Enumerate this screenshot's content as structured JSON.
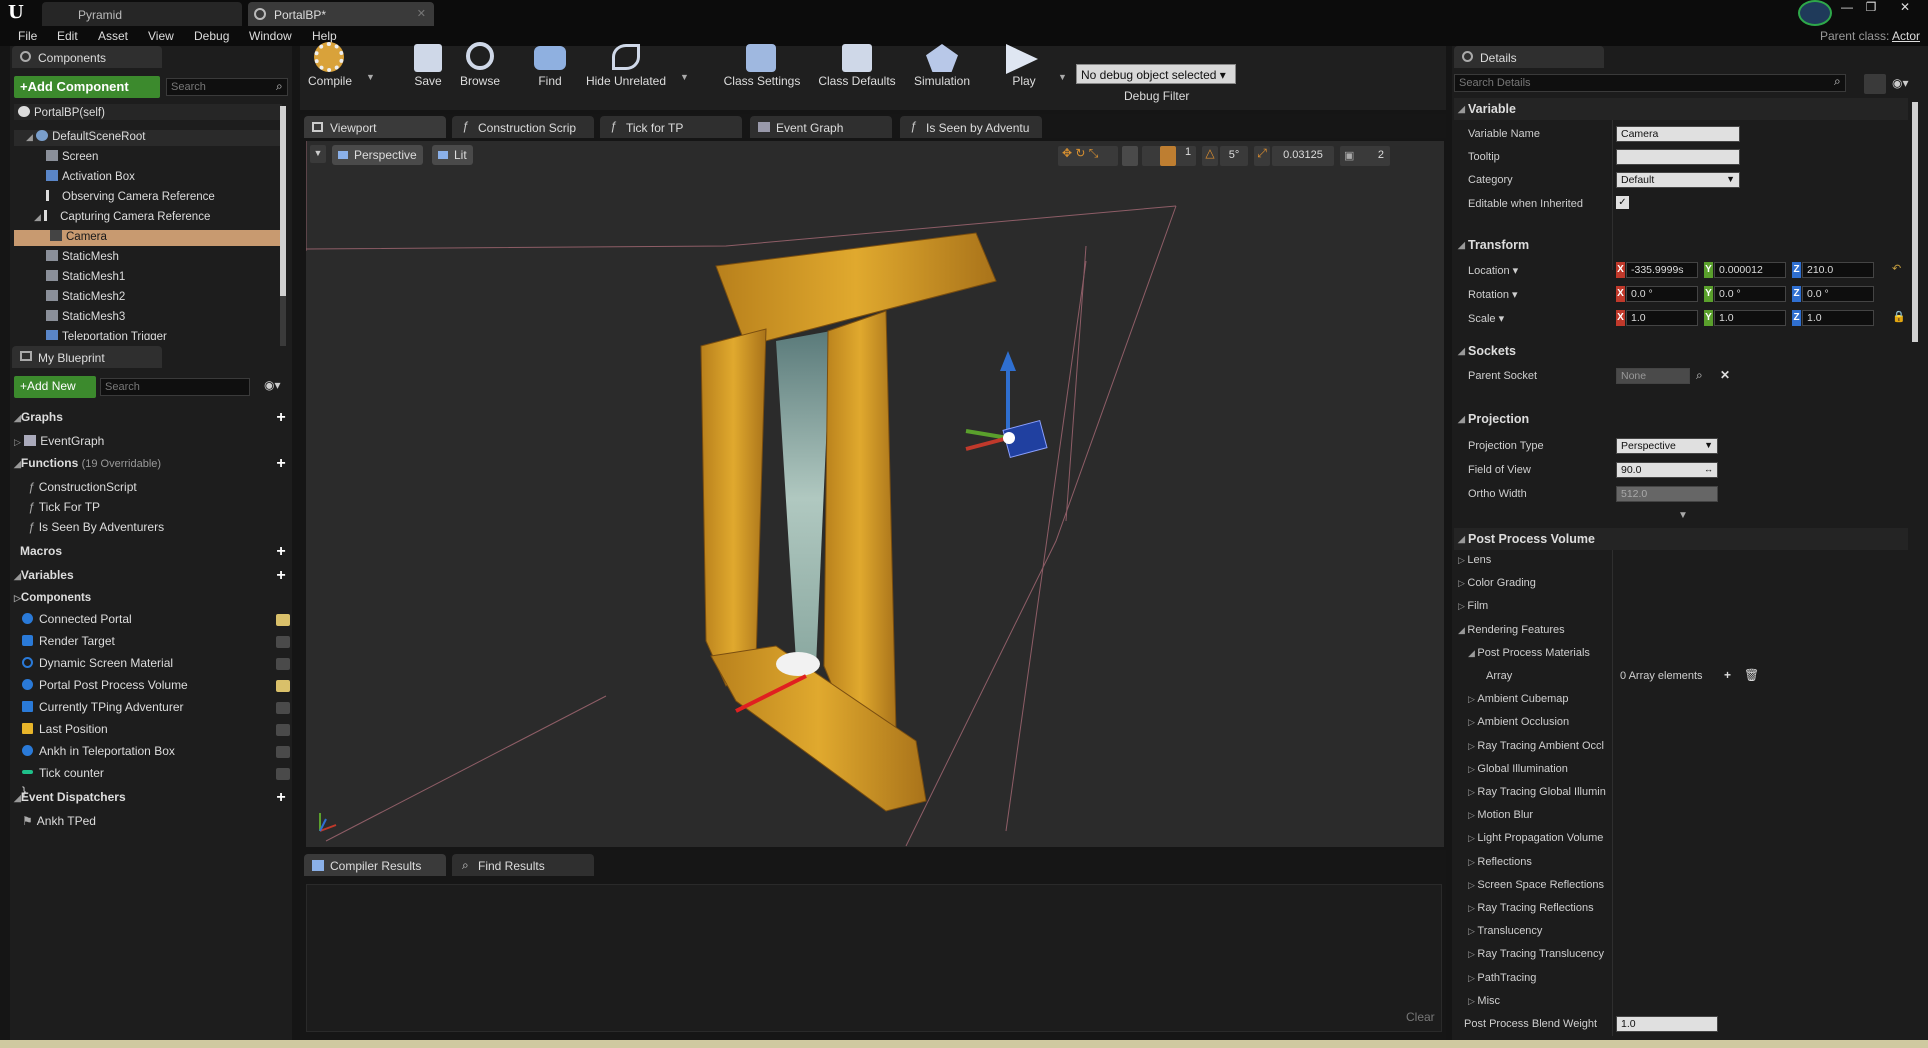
{
  "tabs": [
    {
      "label": "Pyramid"
    },
    {
      "label": "PortalBP*"
    }
  ],
  "menu": [
    "File",
    "Edit",
    "Asset",
    "View",
    "Debug",
    "Window",
    "Help"
  ],
  "parent_class": {
    "label": "Parent class:",
    "value": "Actor"
  },
  "components": {
    "title": "Components",
    "add_label": "+Add Component",
    "search_placeholder": "Search",
    "self_label": "PortalBP(self)",
    "items": [
      "DefaultSceneRoot",
      "Screen",
      "Activation Box",
      "Observing Camera Reference",
      "Capturing Camera Reference",
      "Camera",
      "StaticMesh",
      "StaticMesh1",
      "StaticMesh2",
      "StaticMesh3",
      "Teleportation Trigger"
    ]
  },
  "blueprint": {
    "title": "My Blueprint",
    "add_label": "+Add New",
    "search_placeholder": "Search",
    "graphs_label": "Graphs",
    "event_graph": "EventGraph",
    "functions_label": "Functions",
    "functions_count": "(19 Overridable)",
    "functions": [
      "ConstructionScript",
      "Tick For TP",
      "Is Seen By Adventurers"
    ],
    "macros_label": "Macros",
    "variables_label": "Variables",
    "components_label": "Components",
    "variables": [
      "Connected Portal",
      "Render Target",
      "Dynamic Screen Material",
      "Portal Post Process Volume",
      "Currently TPing Adventurer",
      "Last Position",
      "Ankh in Teleportation Box",
      "Tick counter"
    ],
    "dispatchers_label": "Event Dispatchers",
    "dispatchers": [
      "Ankh TPed"
    ]
  },
  "toolbar": {
    "compile": "Compile",
    "save": "Save",
    "browse": "Browse",
    "find": "Find",
    "hide_unrelated": "Hide Unrelated",
    "class_settings": "Class Settings",
    "class_defaults": "Class Defaults",
    "simulation": "Simulation",
    "play": "Play",
    "debug_object": "No debug object selected",
    "debug_filter": "Debug Filter"
  },
  "editor_tabs": [
    "Viewport",
    "Construction Scrip",
    "Tick for TP",
    "Event Graph",
    "Is Seen by Adventu"
  ],
  "viewport": {
    "perspective": "Perspective",
    "lit": "Lit",
    "snap_angle": "5°",
    "scale_snap": "0.03125",
    "cam_speed": "2"
  },
  "bottom": {
    "tabs": [
      "Compiler Results",
      "Find Results"
    ],
    "clear": "Clear"
  },
  "details": {
    "title": "Details",
    "search_placeholder": "Search Details",
    "variable": {
      "section": "Variable",
      "name_label": "Variable Name",
      "name_value": "Camera",
      "tooltip_label": "Tooltip",
      "category_label": "Category",
      "category_value": "Default",
      "editable_label": "Editable when Inherited"
    },
    "transform": {
      "section": "Transform",
      "location_label": "Location",
      "rotation_label": "Rotation",
      "scale_label": "Scale",
      "location": [
        "-335.9999s",
        "0.000012",
        "210.0"
      ],
      "rotation": [
        "0.0 °",
        "0.0 °",
        "0.0 °"
      ],
      "scale": [
        "1.0",
        "1.0",
        "1.0"
      ]
    },
    "sockets": {
      "section": "Sockets",
      "parent_label": "Parent Socket",
      "parent_value": "None"
    },
    "projection": {
      "section": "Projection",
      "type_label": "Projection Type",
      "type_value": "Perspective",
      "fov_label": "Field of View",
      "fov_value": "90.0",
      "ortho_label": "Ortho Width",
      "ortho_value": "512.0"
    },
    "ppv": {
      "section": "Post Process Volume",
      "items": [
        "Lens",
        "Color Grading",
        "Film",
        "Rendering Features"
      ],
      "ppm_label": "Post Process Materials",
      "array_label": "Array",
      "array_value": "0 Array elements",
      "sub_items": [
        "Ambient Cubemap",
        "Ambient Occlusion",
        "Ray Tracing Ambient Occl",
        "Global Illumination",
        "Ray Tracing Global Illumin",
        "Motion Blur",
        "Light Propagation Volume",
        "Reflections",
        "Screen Space Reflections",
        "Ray Tracing Reflections",
        "Translucency",
        "Ray Tracing Translucency",
        "PathTracing",
        "Misc"
      ],
      "blend_label": "Post Process Blend Weight",
      "blend_value": "1.0"
    }
  },
  "colors": {
    "accent_green": "#3c8a2d",
    "selection": "#c89a70",
    "x_red": "#c0392b",
    "y_green": "#5aa02c",
    "z_blue": "#2f6fd0",
    "portal_gold": "#d4a030"
  }
}
